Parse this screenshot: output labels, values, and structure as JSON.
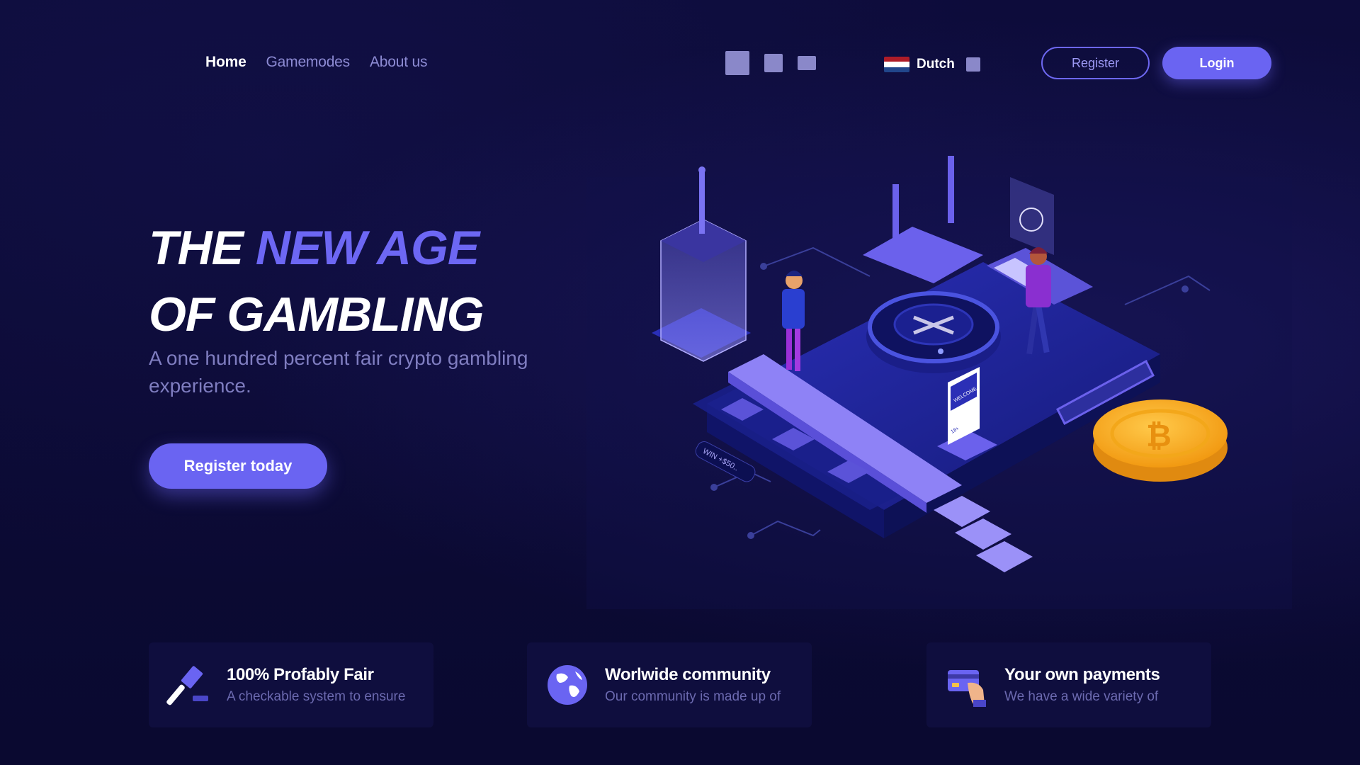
{
  "nav": {
    "links": [
      "Home",
      "Gamemodes",
      "About us"
    ],
    "active_index": 0,
    "social_icons": [
      "social-icon-1",
      "social-icon-2",
      "social-icon-3"
    ],
    "language": {
      "label": "Dutch",
      "flag_colors": [
        "#ae1c28",
        "#ffffff",
        "#21468b"
      ]
    },
    "register_label": "Register",
    "login_label": "Login"
  },
  "hero": {
    "title_line1_a": "THE ",
    "title_line1_b": "NEW AGE",
    "title_line2": "OF GAMBLING",
    "subtitle": "A one hundred percent fair crypto gambling experience.",
    "cta_label": "Register today"
  },
  "illustration": {
    "welcome_sign": "WELCOME",
    "age_label": "18+",
    "win_label": "WIN +$50..",
    "coin_symbol": "₿"
  },
  "features": [
    {
      "icon": "gavel-icon",
      "title": "100% Profably Fair",
      "desc": "A checkable system to ensure"
    },
    {
      "icon": "globe-icon",
      "title": "Worlwide community",
      "desc": "Our community is made up of"
    },
    {
      "icon": "credit-card-icon",
      "title": "Your own payments",
      "desc": "We have a wide variety of"
    }
  ],
  "colors": {
    "background": "#0c0b36",
    "accent": "#6a64f2",
    "muted_text": "#8d8bd4",
    "coin": "#f5a623"
  }
}
